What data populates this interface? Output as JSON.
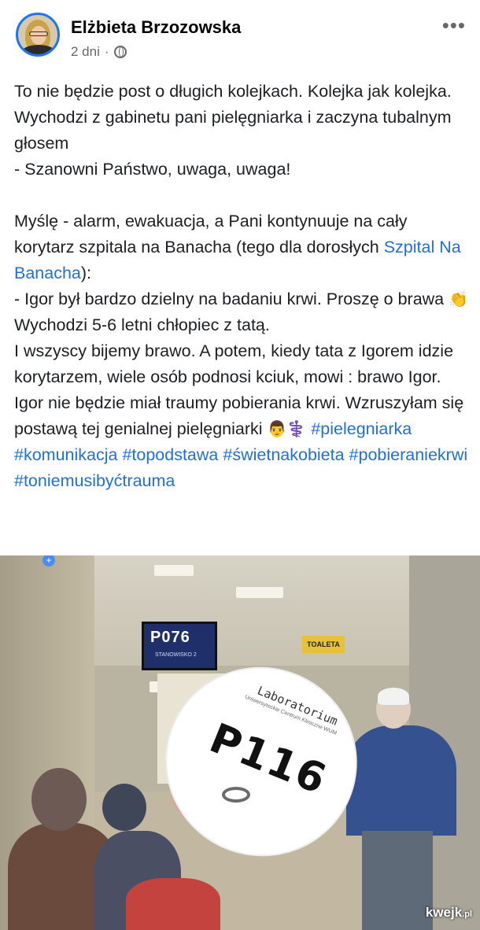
{
  "post": {
    "author": "Elżbieta Brzozowska",
    "time": "2 dni",
    "separator": "·",
    "more": "•••",
    "lines": {
      "p1": "To nie będzie post o długich kolejkach. Kolejka jak kolejka. Wychodzi z gabinetu pani pielęgniarka i zaczyna tubalnym głosem",
      "p2": "- Szanowni Państwo, uwaga, uwaga!",
      "p3a": "Myślę - alarm, ewakuacja, a Pani kontynuuje na cały korytarz szpitala na Banacha (tego dla dorosłych ",
      "p3link": "Szpital Na Banacha",
      "p3b": "):",
      "p4": "- Igor był bardzo dzielny na badaniu krwi. Proszę o brawa",
      "p4emoji": "👏",
      "p5": "Wychodzi 5-6 letni chłopiec z tatą.",
      "p6": "I wszyscy bijemy brawo. A potem, kiedy tata z Igorem idzie korytarzem, wiele osób podnosi kciuk, mowi : brawo Igor. Igor nie będzie miał traumy pobierania krwi. Wzruszyłam się postawą tej genialnej pielęgniarki ",
      "p6emoji": "👨⚕️",
      "tags": [
        "#pielegniarka",
        "#komunikacja",
        "#topodstawa",
        "#świetnakobieta",
        "#pobieraniekrwi",
        "#toniemusibyćtrauma"
      ]
    }
  },
  "photo": {
    "queue_screen": "P076",
    "queue_screen_sub": "STANOWISKO 2",
    "sign": "TOALETA",
    "ticket_header": "Laboratorium",
    "ticket_sub": "Uniwersyteckie Centrum Kliniczne WUM",
    "ticket_number": "P116",
    "badge": "+"
  },
  "watermark": {
    "brand": "kwejk",
    "suffix": ".pl"
  }
}
